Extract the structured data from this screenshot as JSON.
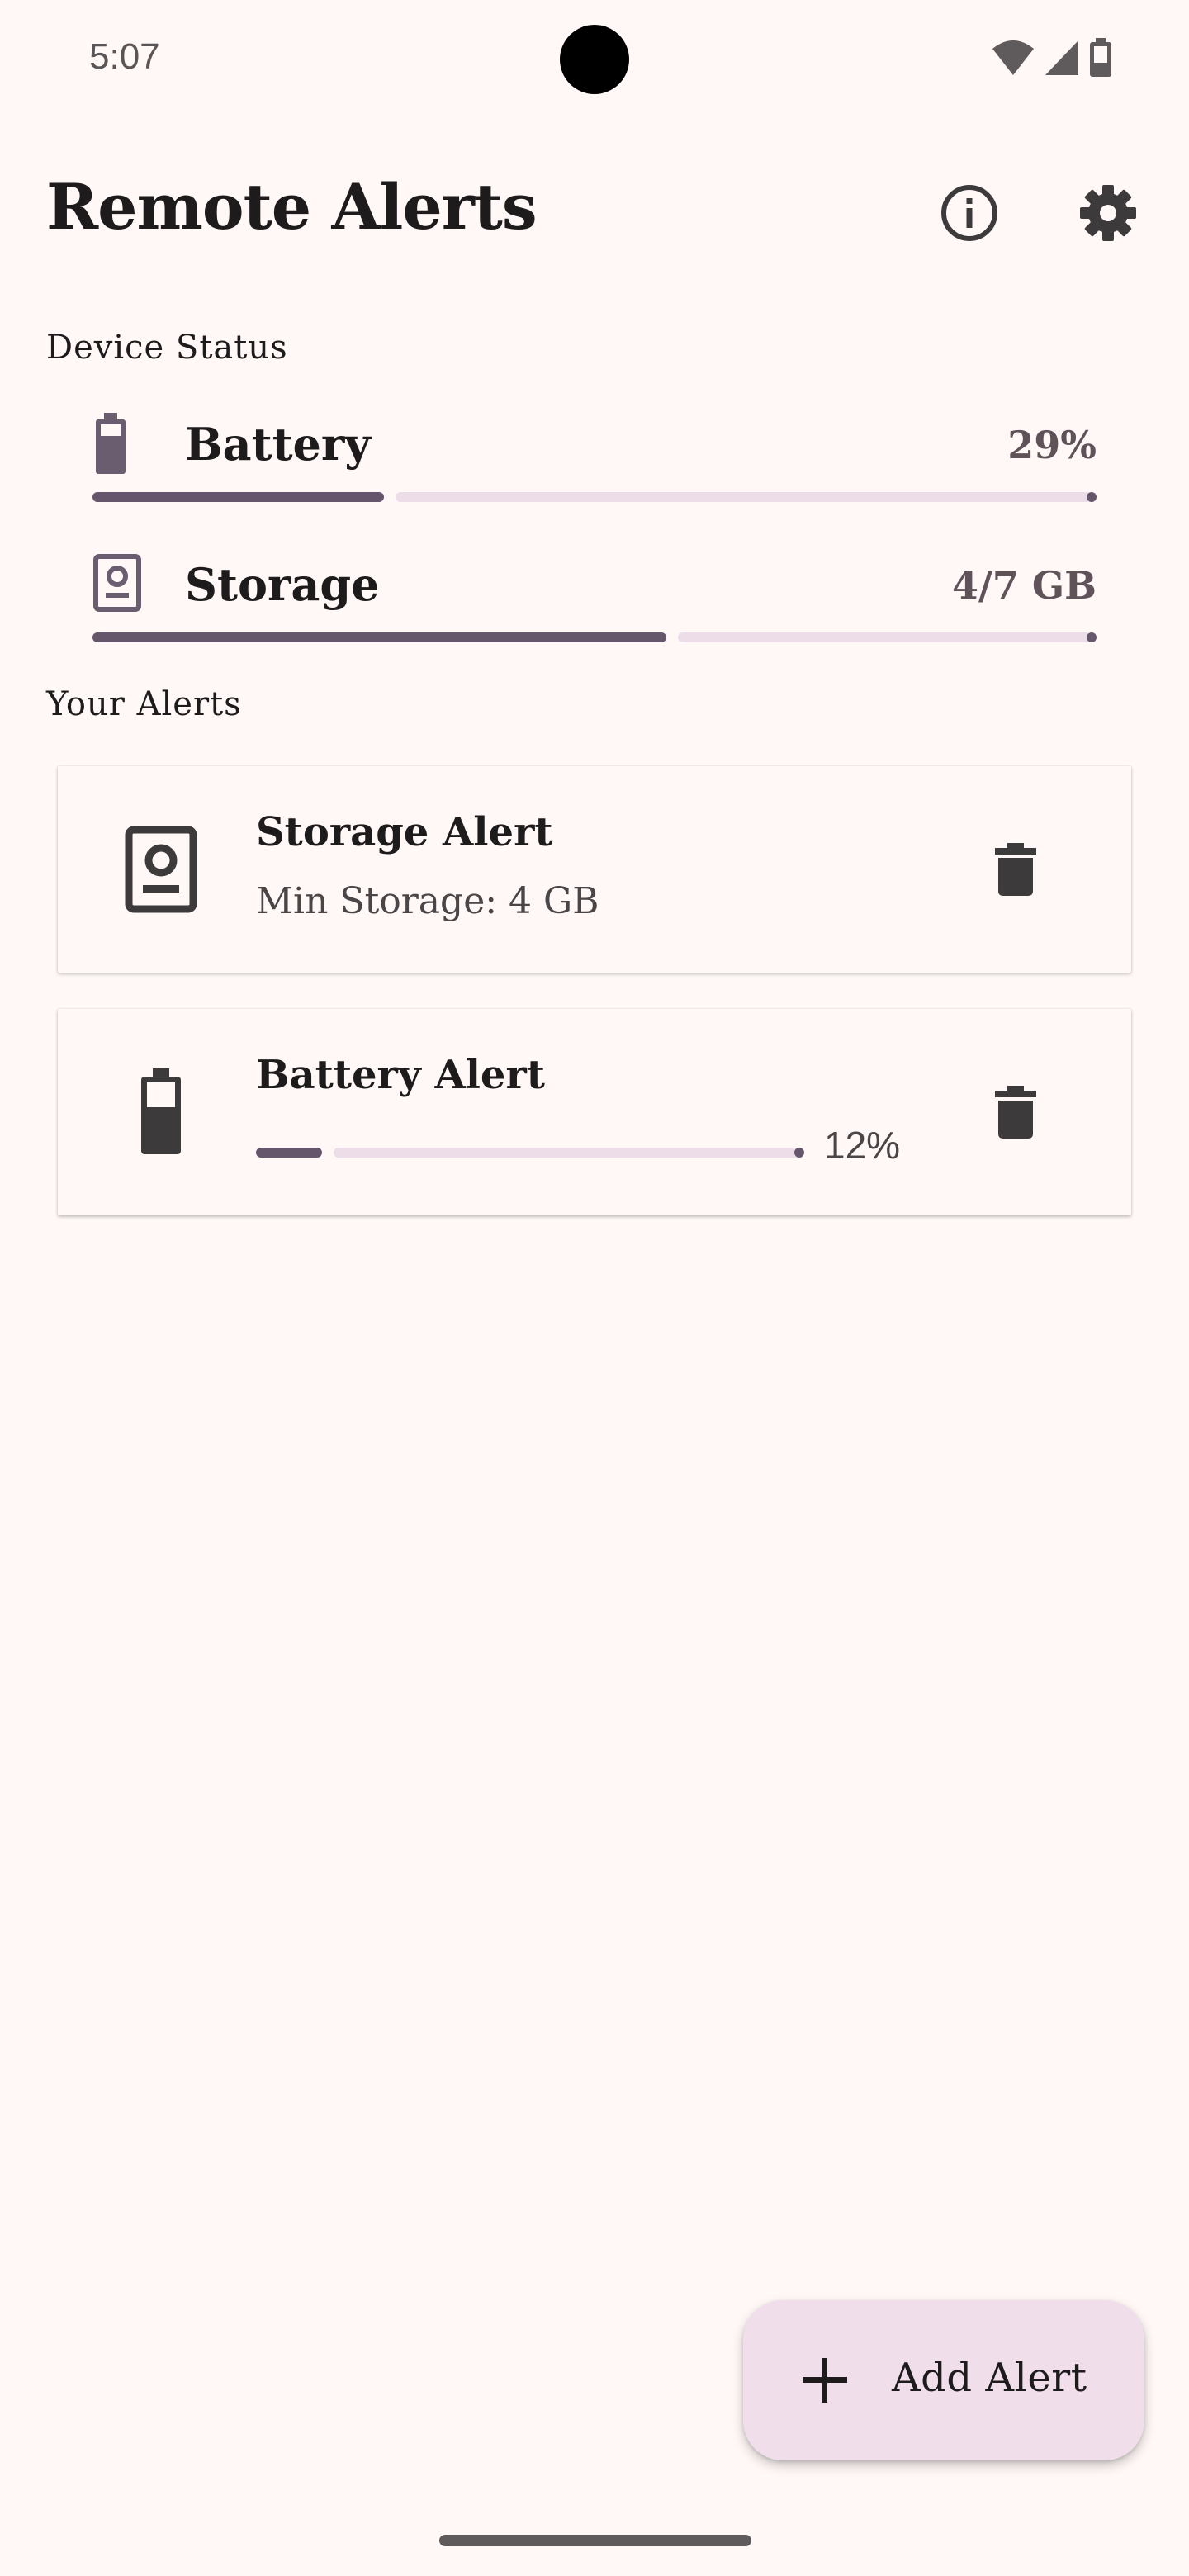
{
  "status_bar": {
    "time": "5:07",
    "icons": [
      "wifi-icon",
      "cell-signal-icon",
      "battery-icon"
    ]
  },
  "app_bar": {
    "title": "Remote Alerts",
    "actions": [
      "info-icon",
      "settings-icon"
    ]
  },
  "device_status": {
    "heading": "Device Status",
    "battery": {
      "label": "Battery",
      "value": "29%",
      "progress": 0.29
    },
    "storage": {
      "label": "Storage",
      "value": "4/7 GB",
      "progress": 0.5714
    }
  },
  "alerts": {
    "heading": "Your Alerts",
    "items": [
      {
        "title": "Storage Alert",
        "subtitle": "Min Storage: 4 GB",
        "icon": "storage-icon"
      },
      {
        "title": "Battery Alert",
        "percent": "12%",
        "progress": 0.12,
        "icon": "battery-icon"
      }
    ]
  },
  "fab": {
    "label": "Add Alert",
    "icon": "plus-icon"
  },
  "colors": {
    "background": "#fff8f7",
    "accent": "#65566b",
    "track": "#ecdde8",
    "fab": "#f0dfeb"
  }
}
